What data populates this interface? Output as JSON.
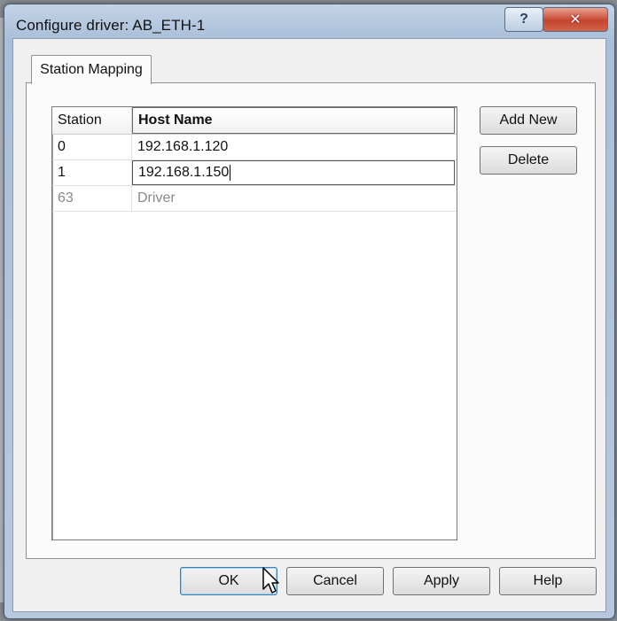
{
  "window": {
    "title": "Configure driver: AB_ETH-1",
    "help_glyph": "?",
    "close_glyph": "✕"
  },
  "tabs": [
    {
      "label": "Station Mapping",
      "selected": true
    }
  ],
  "table": {
    "columns": [
      "Station",
      "Host Name"
    ],
    "rows": [
      {
        "station": "0",
        "host": "192.168.1.120"
      },
      {
        "station": "1",
        "host": "192.168.1.150"
      },
      {
        "station": "63",
        "host": "Driver"
      }
    ]
  },
  "side_buttons": {
    "add_new": "Add New",
    "delete": "Delete"
  },
  "footer_buttons": {
    "ok": "OK",
    "cancel": "Cancel",
    "apply": "Apply",
    "help": "Help"
  }
}
